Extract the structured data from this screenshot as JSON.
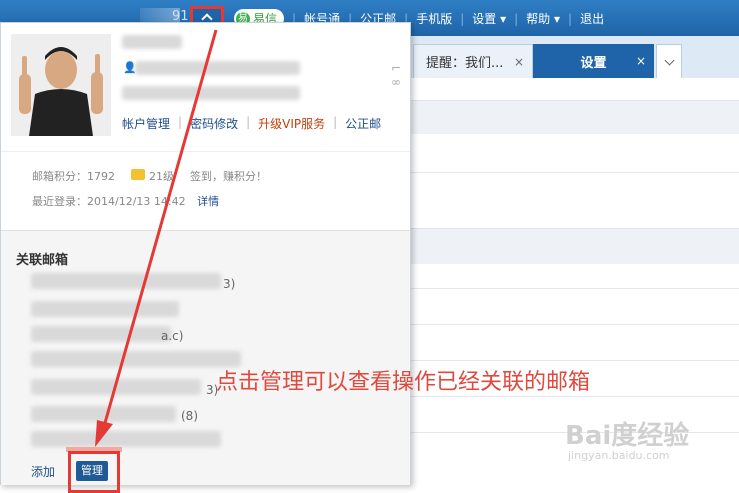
{
  "topbar": {
    "partial_number": "91",
    "yixin_label": "易信",
    "nav": [
      "帐号通",
      "公正邮",
      "手机版",
      "设置",
      "帮助",
      "退出"
    ]
  },
  "tabs": {
    "remind_label": "提醒：我们...",
    "settings_label": "设置",
    "close_glyph": "×"
  },
  "popup": {
    "links": [
      "帐户管理",
      "密码修改",
      "升级VIP服务",
      "公正邮"
    ],
    "points_label": "邮箱积分：1792",
    "level_label": "21级",
    "signin_label": "签到，赚积分！",
    "last_login_label": "最近登录：2014/12/13 14:42",
    "detail_link": "详情",
    "linked_title": "关联邮箱",
    "linked_accounts": [
      {
        "visible_suffix": "3)"
      },
      {
        "visible_suffix": "a.c)"
      },
      {
        "visible_suffix": "3)"
      },
      {
        "visible_suffix": "(8)"
      }
    ],
    "add_label": "添加",
    "manage_label": "管理"
  },
  "annotation": {
    "caption": "点击管理可以查看操作已经关联的邮箱",
    "color": "#e53935"
  },
  "watermark": {
    "line1": "Bai度经验",
    "line2": "jingyan.baidu.com"
  },
  "colors": {
    "topbar": "#1f64a8",
    "link": "#1f4e8c",
    "vip": "#c2410c",
    "highlight": "#e53935"
  }
}
